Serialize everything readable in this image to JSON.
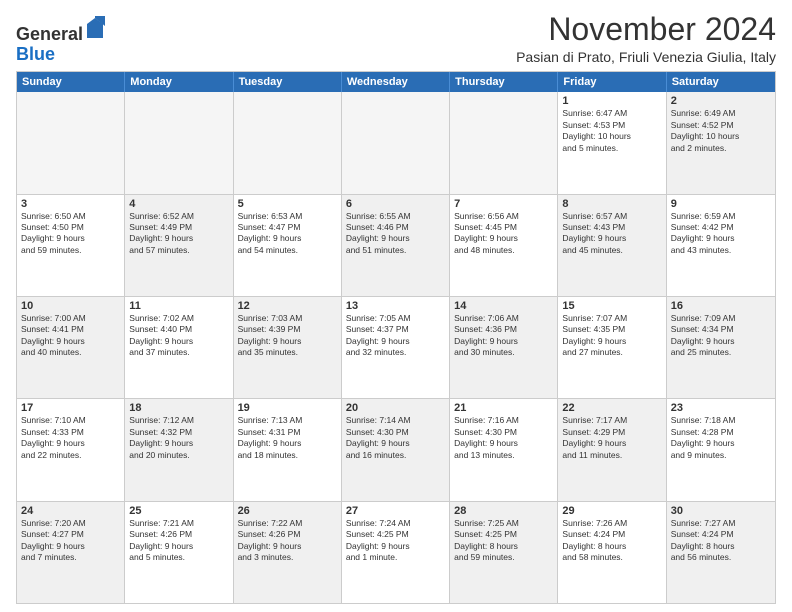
{
  "logo": {
    "general": "General",
    "blue": "Blue"
  },
  "title": "November 2024",
  "subtitle": "Pasian di Prato, Friuli Venezia Giulia, Italy",
  "headers": [
    "Sunday",
    "Monday",
    "Tuesday",
    "Wednesday",
    "Thursday",
    "Friday",
    "Saturday"
  ],
  "rows": [
    [
      {
        "day": "",
        "info": "",
        "empty": true
      },
      {
        "day": "",
        "info": "",
        "empty": true
      },
      {
        "day": "",
        "info": "",
        "empty": true
      },
      {
        "day": "",
        "info": "",
        "empty": true
      },
      {
        "day": "",
        "info": "",
        "empty": true
      },
      {
        "day": "1",
        "info": "Sunrise: 6:47 AM\nSunset: 4:53 PM\nDaylight: 10 hours\nand 5 minutes."
      },
      {
        "day": "2",
        "info": "Sunrise: 6:49 AM\nSunset: 4:52 PM\nDaylight: 10 hours\nand 2 minutes.",
        "shaded": true
      }
    ],
    [
      {
        "day": "3",
        "info": "Sunrise: 6:50 AM\nSunset: 4:50 PM\nDaylight: 9 hours\nand 59 minutes."
      },
      {
        "day": "4",
        "info": "Sunrise: 6:52 AM\nSunset: 4:49 PM\nDaylight: 9 hours\nand 57 minutes.",
        "shaded": true
      },
      {
        "day": "5",
        "info": "Sunrise: 6:53 AM\nSunset: 4:47 PM\nDaylight: 9 hours\nand 54 minutes."
      },
      {
        "day": "6",
        "info": "Sunrise: 6:55 AM\nSunset: 4:46 PM\nDaylight: 9 hours\nand 51 minutes.",
        "shaded": true
      },
      {
        "day": "7",
        "info": "Sunrise: 6:56 AM\nSunset: 4:45 PM\nDaylight: 9 hours\nand 48 minutes."
      },
      {
        "day": "8",
        "info": "Sunrise: 6:57 AM\nSunset: 4:43 PM\nDaylight: 9 hours\nand 45 minutes.",
        "shaded": true
      },
      {
        "day": "9",
        "info": "Sunrise: 6:59 AM\nSunset: 4:42 PM\nDaylight: 9 hours\nand 43 minutes."
      }
    ],
    [
      {
        "day": "10",
        "info": "Sunrise: 7:00 AM\nSunset: 4:41 PM\nDaylight: 9 hours\nand 40 minutes.",
        "shaded": true
      },
      {
        "day": "11",
        "info": "Sunrise: 7:02 AM\nSunset: 4:40 PM\nDaylight: 9 hours\nand 37 minutes."
      },
      {
        "day": "12",
        "info": "Sunrise: 7:03 AM\nSunset: 4:39 PM\nDaylight: 9 hours\nand 35 minutes.",
        "shaded": true
      },
      {
        "day": "13",
        "info": "Sunrise: 7:05 AM\nSunset: 4:37 PM\nDaylight: 9 hours\nand 32 minutes."
      },
      {
        "day": "14",
        "info": "Sunrise: 7:06 AM\nSunset: 4:36 PM\nDaylight: 9 hours\nand 30 minutes.",
        "shaded": true
      },
      {
        "day": "15",
        "info": "Sunrise: 7:07 AM\nSunset: 4:35 PM\nDaylight: 9 hours\nand 27 minutes."
      },
      {
        "day": "16",
        "info": "Sunrise: 7:09 AM\nSunset: 4:34 PM\nDaylight: 9 hours\nand 25 minutes.",
        "shaded": true
      }
    ],
    [
      {
        "day": "17",
        "info": "Sunrise: 7:10 AM\nSunset: 4:33 PM\nDaylight: 9 hours\nand 22 minutes."
      },
      {
        "day": "18",
        "info": "Sunrise: 7:12 AM\nSunset: 4:32 PM\nDaylight: 9 hours\nand 20 minutes.",
        "shaded": true
      },
      {
        "day": "19",
        "info": "Sunrise: 7:13 AM\nSunset: 4:31 PM\nDaylight: 9 hours\nand 18 minutes."
      },
      {
        "day": "20",
        "info": "Sunrise: 7:14 AM\nSunset: 4:30 PM\nDaylight: 9 hours\nand 16 minutes.",
        "shaded": true
      },
      {
        "day": "21",
        "info": "Sunrise: 7:16 AM\nSunset: 4:30 PM\nDaylight: 9 hours\nand 13 minutes."
      },
      {
        "day": "22",
        "info": "Sunrise: 7:17 AM\nSunset: 4:29 PM\nDaylight: 9 hours\nand 11 minutes.",
        "shaded": true
      },
      {
        "day": "23",
        "info": "Sunrise: 7:18 AM\nSunset: 4:28 PM\nDaylight: 9 hours\nand 9 minutes."
      }
    ],
    [
      {
        "day": "24",
        "info": "Sunrise: 7:20 AM\nSunset: 4:27 PM\nDaylight: 9 hours\nand 7 minutes.",
        "shaded": true
      },
      {
        "day": "25",
        "info": "Sunrise: 7:21 AM\nSunset: 4:26 PM\nDaylight: 9 hours\nand 5 minutes."
      },
      {
        "day": "26",
        "info": "Sunrise: 7:22 AM\nSunset: 4:26 PM\nDaylight: 9 hours\nand 3 minutes.",
        "shaded": true
      },
      {
        "day": "27",
        "info": "Sunrise: 7:24 AM\nSunset: 4:25 PM\nDaylight: 9 hours\nand 1 minute."
      },
      {
        "day": "28",
        "info": "Sunrise: 7:25 AM\nSunset: 4:25 PM\nDaylight: 8 hours\nand 59 minutes.",
        "shaded": true
      },
      {
        "day": "29",
        "info": "Sunrise: 7:26 AM\nSunset: 4:24 PM\nDaylight: 8 hours\nand 58 minutes."
      },
      {
        "day": "30",
        "info": "Sunrise: 7:27 AM\nSunset: 4:24 PM\nDaylight: 8 hours\nand 56 minutes.",
        "shaded": true
      }
    ]
  ]
}
